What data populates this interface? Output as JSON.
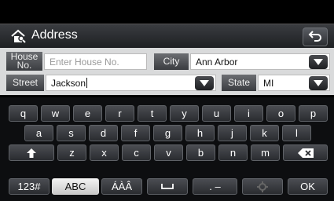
{
  "header": {
    "title": "Address",
    "home_icon": "home-search-icon",
    "back_icon": "back-arrow-icon"
  },
  "fields": {
    "house_no": {
      "label": "House\nNo.",
      "placeholder": "Enter House No."
    },
    "city": {
      "label": "City",
      "value": "Ann Arbor"
    },
    "street": {
      "label": "Street",
      "value": "Jackson"
    },
    "state": {
      "label": "State",
      "value": "MI"
    }
  },
  "keyboard": {
    "row1": [
      "q",
      "w",
      "e",
      "r",
      "t",
      "y",
      "u",
      "i",
      "o",
      "p"
    ],
    "row2": [
      "a",
      "s",
      "d",
      "f",
      "g",
      "h",
      "j",
      "k",
      "l"
    ],
    "row3": [
      "z",
      "x",
      "c",
      "v",
      "b",
      "n",
      "m"
    ],
    "mode_123": "123#",
    "mode_abc": "ABC",
    "mode_accents": "ÁÀÂ",
    "dot_dash": ". –",
    "ok": "OK",
    "shift_icon": "shift-arrow-icon",
    "backspace_icon": "backspace-icon",
    "space_icon": "space-icon",
    "settings_icon": "gear-icon"
  },
  "colors": {
    "header_bg": "#2a2c30",
    "panel_bg": "#d9dadb",
    "key_bg": "#3a3c40",
    "key_selected_bg": "#e6e6e6"
  }
}
